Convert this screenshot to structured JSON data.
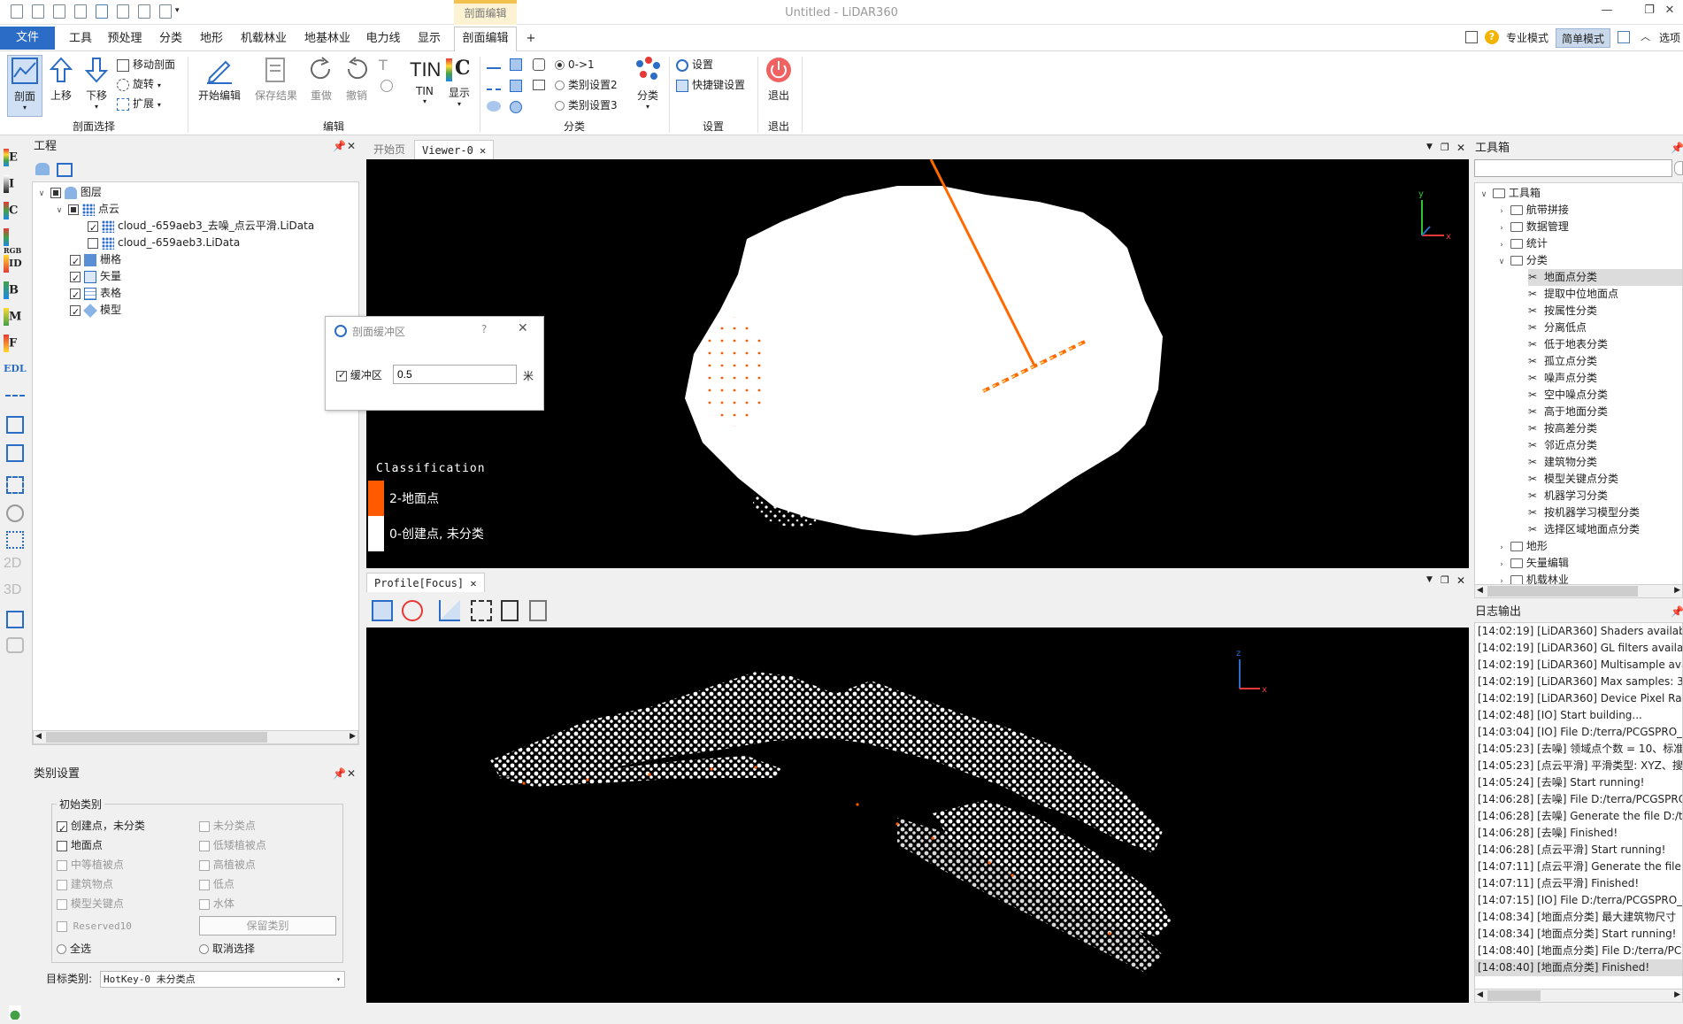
{
  "window": {
    "title": "Untitled - LiDAR360",
    "context_tab": "剖面编辑"
  },
  "menubar": {
    "file": "文件",
    "items": [
      "工具",
      "预处理",
      "分类",
      "地形",
      "机载林业",
      "地基林业",
      "电力线",
      "显示",
      "剖面编辑",
      "+"
    ],
    "right": {
      "pro_mode": "专业模式",
      "simple_mode": "简单模式",
      "options": "选项"
    }
  },
  "ribbon": {
    "profile_select": {
      "label": "剖面选择",
      "profile": "剖面",
      "up": "上移",
      "down": "下移",
      "move": "移动剖面",
      "rotate": "旋转",
      "extend": "扩展"
    },
    "edit": {
      "label": "编辑",
      "start": "开始编辑",
      "save": "保存结果",
      "redo": "重做",
      "undo": "撤销",
      "tin": "TIN",
      "tin_icon_text": "TIN",
      "display": "显示",
      "display_icon_text": "C"
    },
    "classify": {
      "label": "分类",
      "opt1": "0->1",
      "opt2": "类别设置2",
      "opt3": "类别设置3",
      "classify": "分类"
    },
    "settings": {
      "label": "设置",
      "settings": "设置",
      "shortcut": "快捷键设置"
    },
    "exit": {
      "label": "退出",
      "exit": "退出"
    }
  },
  "left_toolbar": [
    "E",
    "I",
    "C",
    "RGB",
    "ID",
    "B",
    "M",
    "F",
    "EDL",
    "2D",
    "3D"
  ],
  "project": {
    "title": "工程",
    "tree": {
      "layers": "图层",
      "pointcloud": "点云",
      "file1": "cloud_-659aeb3_去噪_点云平滑.LiData",
      "file2": "cloud_-659aeb3.LiData",
      "raster": "栅格",
      "vector": "矢量",
      "table": "表格",
      "model": "模型"
    }
  },
  "class_settings": {
    "title": "类别设置",
    "group": "初始类别",
    "left": [
      "创建点，未分类",
      "地面点",
      "中等植被点",
      "建筑物点",
      "模型关键点",
      "Reserved10"
    ],
    "right": [
      "未分类点",
      "低矮植被点",
      "高植被点",
      "低点",
      "水体"
    ],
    "keep": "保留类别",
    "select_all": "全选",
    "deselect": "取消选择",
    "target_label": "目标类别:",
    "target_value": "HotKey-0  未分类点"
  },
  "viewer": {
    "tabs": [
      "开始页",
      "Viewer-0"
    ],
    "legend_title": "Classification",
    "legend": [
      {
        "label": "2-地面点",
        "color": "#ff5a00"
      },
      {
        "label": "0-创建点, 未分类",
        "color": "#ffffff"
      }
    ],
    "axis_y": "y",
    "axis_x": "x"
  },
  "profile_view": {
    "tab": "Profile[Focus]",
    "axis_y": "z",
    "axis_x": "x"
  },
  "dialog": {
    "title": "剖面缓冲区",
    "help": "?",
    "label": "缓冲区",
    "value": "0.5",
    "unit": "米"
  },
  "toolbox": {
    "title": "工具箱",
    "root": "工具箱",
    "groups_before": [
      "航带拼接",
      "数据管理",
      "统计"
    ],
    "classify_group": "分类",
    "classify_items": [
      "地面点分类",
      "提取中位地面点",
      "按属性分类",
      "分离低点",
      "低于地表分类",
      "孤立点分类",
      "噪声点分类",
      "空中噪点分类",
      "高于地面分类",
      "按高差分类",
      "邻近点分类",
      "建筑物分类",
      "模型关键点分类",
      "机器学习分类",
      "按机器学习模型分类",
      "选择区域地面点分类"
    ],
    "groups_after": [
      "地形",
      "矢量编辑",
      "机载林业"
    ]
  },
  "log": {
    "title": "日志输出",
    "rows": [
      "[14:02:19] [LiDAR360]   Shaders availab",
      "[14:02:19] [LiDAR360]   GL filters availab",
      "[14:02:19] [LiDAR360]   Multisample ava",
      "[14:02:19] [LiDAR360]   Max samples: 3",
      "[14:02:19] [LiDAR360]   Device Pixel Rati",
      "[14:02:48] [IO]   Start building...",
      "[14:03:04] [IO]   File D:/terra/PCGSPRO_",
      "[14:05:23] [去噪]   领域点个数 = 10、标准",
      "[14:05:23] [点云平滑]   平滑类型: XYZ、搜",
      "[14:05:24] [去噪]   Start running!",
      "[14:06:28] [去噪]   File D:/terra/PCGSPRO",
      "[14:06:28] [去噪]   Generate the file D:/te",
      "[14:06:28] [去噪]   Finished!",
      "[14:06:28] [点云平滑]   Start running!",
      "[14:07:11] [点云平滑]   Generate the file",
      "[14:07:11] [点云平滑]   Finished!",
      "[14:07:15] [IO]   File D:/terra/PCGSPRO_",
      "[14:08:34] [地面点分类]   最大建筑物尺寸",
      "[14:08:34] [地面点分类]   Start running!",
      "[14:08:40] [地面点分类]   File D:/terra/PC",
      "[14:08:40] [地面点分类]   Finished!"
    ]
  },
  "colors": {
    "accent": "#2b6cc7",
    "ground": "#ff5a00",
    "context": "#f2c14e"
  }
}
